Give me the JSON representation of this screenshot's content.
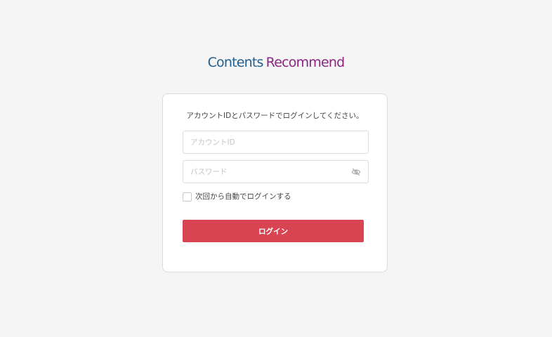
{
  "logo": {
    "word1": "Contents",
    "word2": "Recommend",
    "colors": {
      "word1": "#1f5e8e",
      "word2": "#8e2383"
    }
  },
  "login": {
    "instruction": "アカウントIDとパスワードでログインしてください。",
    "account_id": {
      "value": "",
      "placeholder": "アカウントID"
    },
    "password": {
      "value": "",
      "placeholder": "パスワード",
      "toggle_icon": "eye-slash-icon"
    },
    "remember_label": "次回から自動でログインする",
    "remember_checked": false,
    "submit_label": "ログイン"
  },
  "colors": {
    "background": "#f5f5f5",
    "card": "#ffffff",
    "accent": "#d94452"
  }
}
